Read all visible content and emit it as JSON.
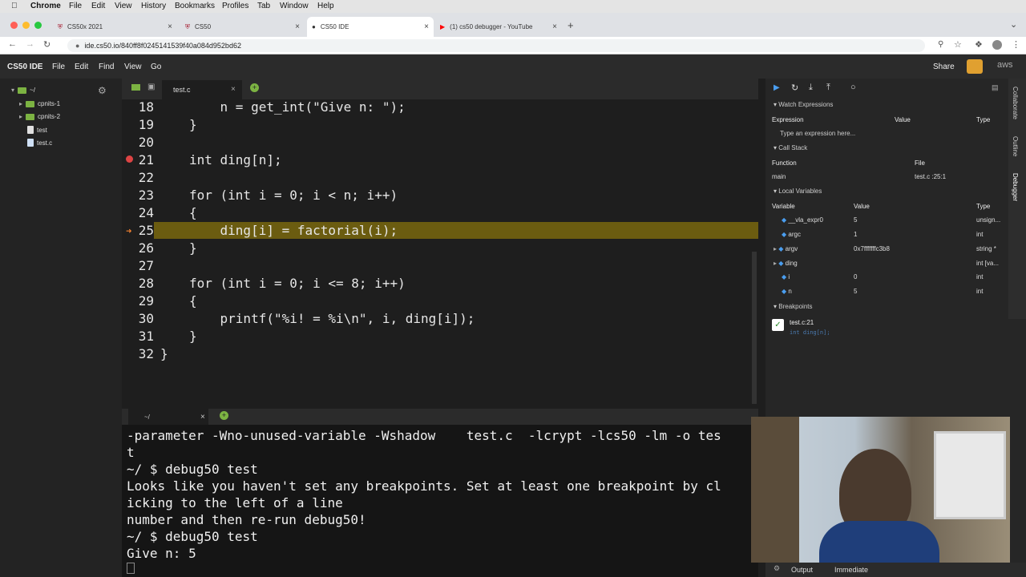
{
  "mac_menu": {
    "app": "Chrome",
    "items": [
      "File",
      "Edit",
      "View",
      "History",
      "Bookmarks",
      "Profiles",
      "Tab",
      "Window",
      "Help"
    ]
  },
  "browser_tabs": [
    {
      "label": "CS50x 2021"
    },
    {
      "label": "CS50"
    },
    {
      "label": "CS50 IDE"
    },
    {
      "label": "(1) cs50 debugger - YouTube"
    }
  ],
  "address": "ide.cs50.io/840ff8f0245141539f40a084d952bd62",
  "ide": {
    "brand": "CS50 IDE",
    "menu": [
      "File",
      "Edit",
      "Find",
      "View",
      "Go"
    ],
    "share": "Share"
  },
  "tree": {
    "root": "~/",
    "items": [
      "cpnits-1",
      "cpnits-2",
      "test",
      "test.c"
    ]
  },
  "editor_tab": "test.c",
  "code": [
    {
      "n": "18",
      "t": "    n = get_int(\"Give n: \");"
    },
    {
      "n": "19",
      "t": "}"
    },
    {
      "n": "20",
      "t": ""
    },
    {
      "n": "21",
      "t": "int ding[n];"
    },
    {
      "n": "22",
      "t": ""
    },
    {
      "n": "23",
      "t": "for (int i = 0; i < n; i++)"
    },
    {
      "n": "24",
      "t": "{"
    },
    {
      "n": "25",
      "t": "    ding[i] = factorial(i);"
    },
    {
      "n": "26",
      "t": "}"
    },
    {
      "n": "27",
      "t": ""
    },
    {
      "n": "28",
      "t": "for (int i = 0; i <= 8; i++)"
    },
    {
      "n": "29",
      "t": "{"
    },
    {
      "n": "30",
      "t": "    printf(\"%i! = %i\\n\", i, ding[i]);"
    },
    {
      "n": "31",
      "t": "}"
    },
    {
      "n": "32",
      "t": "}"
    }
  ],
  "terminal_tab": "~/",
  "terminal": [
    "-parameter -Wno-unused-variable -Wshadow    test.c  -lcrypt -lcs50 -lm -o tes",
    "t",
    "~/ $ debug50 test",
    "Looks like you haven't set any breakpoints. Set at least one breakpoint by cl",
    "icking to the left of a line",
    "number and then re-run debug50!",
    "~/ $ debug50 test",
    "Give n: 5"
  ],
  "debugger": {
    "watch_title": "Watch Expressions",
    "watch_cols": [
      "Expression",
      "Value",
      "Type"
    ],
    "watch_placeholder": "Type an expression here...",
    "callstack_title": "Call Stack",
    "callstack_cols": [
      "Function",
      "File"
    ],
    "callstack_row": {
      "fn": "main",
      "file": "test.c :25:1"
    },
    "locals_title": "Local Variables",
    "locals_cols": [
      "Variable",
      "Value",
      "Type"
    ],
    "locals": [
      {
        "name": "__vla_expr0",
        "value": "5",
        "type": "unsign..."
      },
      {
        "name": "argc",
        "value": "1",
        "type": "int"
      },
      {
        "name": "argv",
        "value": "0x7fffffffc3b8",
        "type": "string *"
      },
      {
        "name": "ding",
        "value": "",
        "type": "int [va..."
      },
      {
        "name": "i",
        "value": "0",
        "type": "int"
      },
      {
        "name": "n",
        "value": "5",
        "type": "int"
      }
    ],
    "bp_title": "Breakpoints",
    "bp_file": "test.c:21",
    "bp_code": "int ding[n];"
  },
  "rail": [
    "Collaborate",
    "Outline",
    "Debugger"
  ],
  "status": {
    "output": "Output",
    "immediate": "Immediate"
  }
}
